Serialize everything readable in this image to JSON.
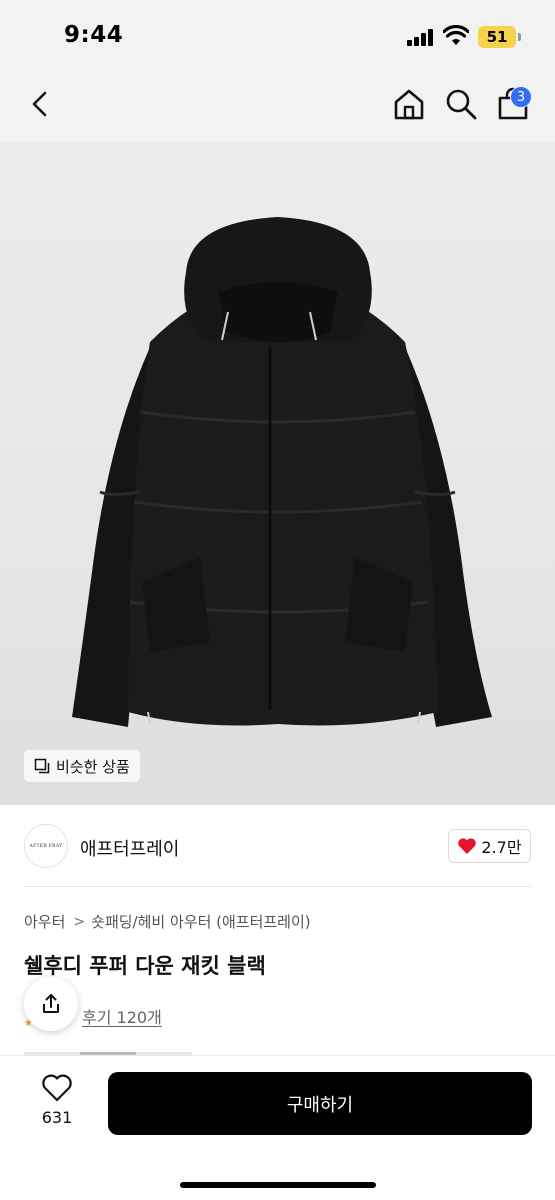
{
  "status_bar": {
    "time": "9:44",
    "battery": "51"
  },
  "nav": {
    "cart_count": "3"
  },
  "product": {
    "similar_label": "비슷한 상품",
    "brand_logo_text": "AFTER PRAY",
    "brand_name": "애프터프레이",
    "like_count": "2.7만",
    "breadcrumb": [
      "아우터",
      "숏패딩/헤비 아우터 (애프터프레이)"
    ],
    "title": "쉘후디 푸퍼 다운 재킷 블랙",
    "reviews_label": "후기 120개"
  },
  "bottom_bar": {
    "wish_count": "631",
    "buy_label": "구매하기"
  },
  "colors": {
    "accent_blue": "#2f6df6",
    "heart_red": "#e8132c",
    "buy_black": "#000000"
  }
}
